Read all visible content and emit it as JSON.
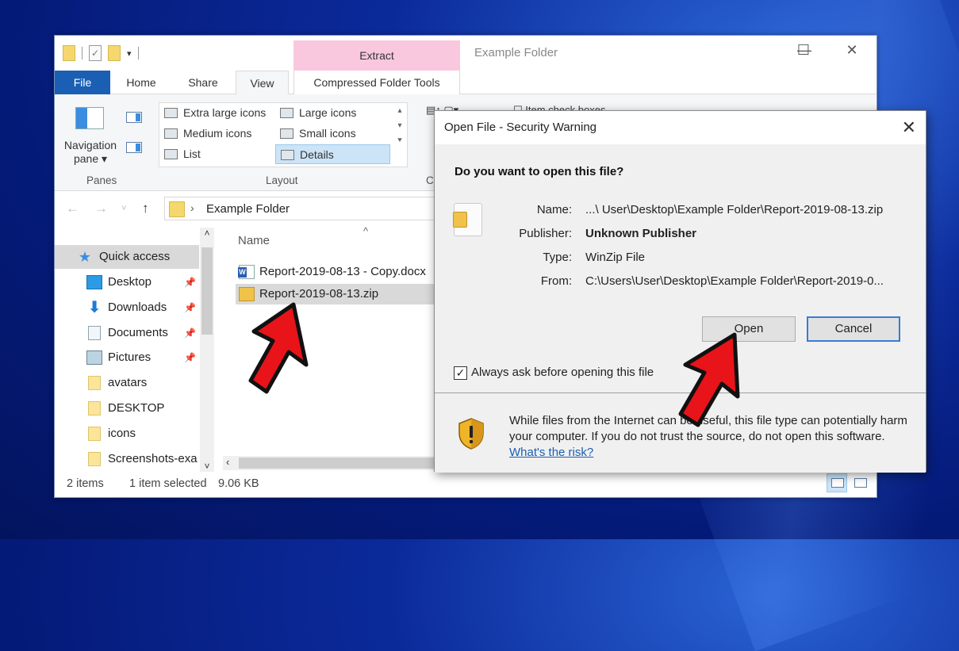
{
  "explorer": {
    "window_title": "Example Folder",
    "context_tab": "Extract",
    "tabs": [
      {
        "label": "File"
      },
      {
        "label": "Home"
      },
      {
        "label": "Share"
      },
      {
        "label": "View"
      },
      {
        "label": "Compressed Folder Tools"
      }
    ],
    "active_tab": "View",
    "ribbon": {
      "panes_group": "Panes",
      "navigation_pane_label": "Navigation pane ▾",
      "layout_group": "Layout",
      "layout_items": [
        {
          "label": "Extra large icons"
        },
        {
          "label": "Large icons"
        },
        {
          "label": "Medium icons"
        },
        {
          "label": "Small icons"
        },
        {
          "label": "List"
        },
        {
          "label": "Details"
        }
      ],
      "selected_layout": "Details",
      "item_check_boxes_label": "Item check boxes",
      "current_view_group_partial": "C"
    },
    "address": {
      "path": "Example Folder"
    },
    "sidebar": {
      "items": [
        {
          "label": "Quick access",
          "icon": "star-icon",
          "pinned": false
        },
        {
          "label": "Desktop",
          "icon": "desktop-icon",
          "pinned": true
        },
        {
          "label": "Downloads",
          "icon": "download-icon",
          "pinned": true
        },
        {
          "label": "Documents",
          "icon": "documents-icon",
          "pinned": true
        },
        {
          "label": "Pictures",
          "icon": "pictures-icon",
          "pinned": true
        },
        {
          "label": "avatars",
          "icon": "folder-icon",
          "pinned": false
        },
        {
          "label": "DESKTOP",
          "icon": "folder-icon",
          "pinned": false
        },
        {
          "label": "icons",
          "icon": "folder-icon",
          "pinned": false
        },
        {
          "label": "Screenshots-exa",
          "icon": "folder-icon",
          "pinned": false
        }
      ]
    },
    "content": {
      "column_name": "Name",
      "files": [
        {
          "name": "Report-2019-08-13 - Copy.docx",
          "icon": "word-doc-icon",
          "selected": false
        },
        {
          "name": "Report-2019-08-13.zip",
          "icon": "zip-icon",
          "selected": true
        }
      ]
    },
    "status": {
      "items_count": "2 items",
      "selection": "1 item selected",
      "size": "9.06 KB"
    }
  },
  "dialog": {
    "title": "Open File - Security Warning",
    "question": "Do you want to open this file?",
    "fields": [
      {
        "label": "Name:",
        "value": "...\\ User\\Desktop\\Example Folder\\Report-2019-08-13.zip",
        "bold": false
      },
      {
        "label": "Publisher:",
        "value": "Unknown Publisher",
        "bold": true
      },
      {
        "label": "Type:",
        "value": "WinZip File",
        "bold": false
      },
      {
        "label": "From:",
        "value": "C:\\Users\\User\\Desktop\\Example Folder\\Report-2019-0...",
        "bold": false
      }
    ],
    "open_label": "Open",
    "cancel_label": "Cancel",
    "always_ask_label": "Always ask before opening this file",
    "always_ask_checked": true,
    "warning_text": "While files from the Internet can be useful, this file type can potentially harm your computer. If you do not trust the source, do not open this software.",
    "risk_link": "What's the risk?"
  },
  "colors": {
    "accent": "#1a5fb4",
    "context_tab": "#f9c8df",
    "annotation_arrow": "#e8141a"
  }
}
